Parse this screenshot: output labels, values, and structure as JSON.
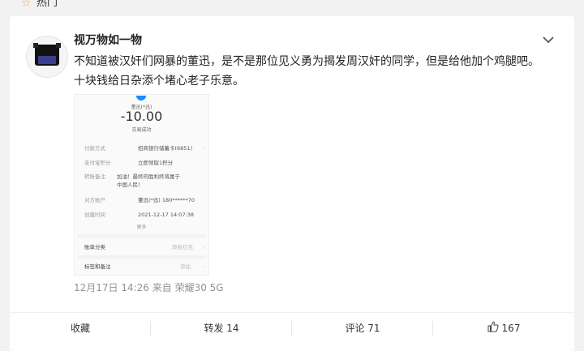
{
  "topbar": {
    "label": "热门"
  },
  "post": {
    "username": "视万物如一物",
    "text_line1": "不知道被汉奸们网暴的董迅，是不是那位见义勇为揭发周汉奸的同学，但是给他加个鸡腿吧。",
    "text_line2": "十块钱给日杂添个堵心老子乐意。",
    "meta": "12月17日 14:26  来自 荣耀30 5G"
  },
  "receipt": {
    "payee": "董迅(*迅)",
    "amount": "-10.00",
    "status": "交易成功",
    "rows": [
      {
        "key": "付款方式",
        "value": "招商银行储蓄卡(6851)"
      },
      {
        "key": "支付宝积分",
        "value": "立即领取1积分"
      },
      {
        "key": "转账备注",
        "value": "加油！最终的胜利终将属于中国人民！"
      },
      {
        "key": "对方账户",
        "value": "董迅(*迅) 180******70"
      },
      {
        "key": "创建时间",
        "value": "2021-12-17 14:07:38"
      }
    ],
    "more": "更多",
    "bill_category": "账单分类",
    "bill_category_value": "转账红包",
    "tags_notes": "标签和备注",
    "tags_notes_value": "添加"
  },
  "actions": {
    "favorite": "收藏",
    "repost": "转发 14",
    "comment": "评论 71",
    "like": "167"
  },
  "colors": {
    "hot_icon": "#f3a33a",
    "meta": "#939393",
    "accent": "#1a8cff"
  }
}
